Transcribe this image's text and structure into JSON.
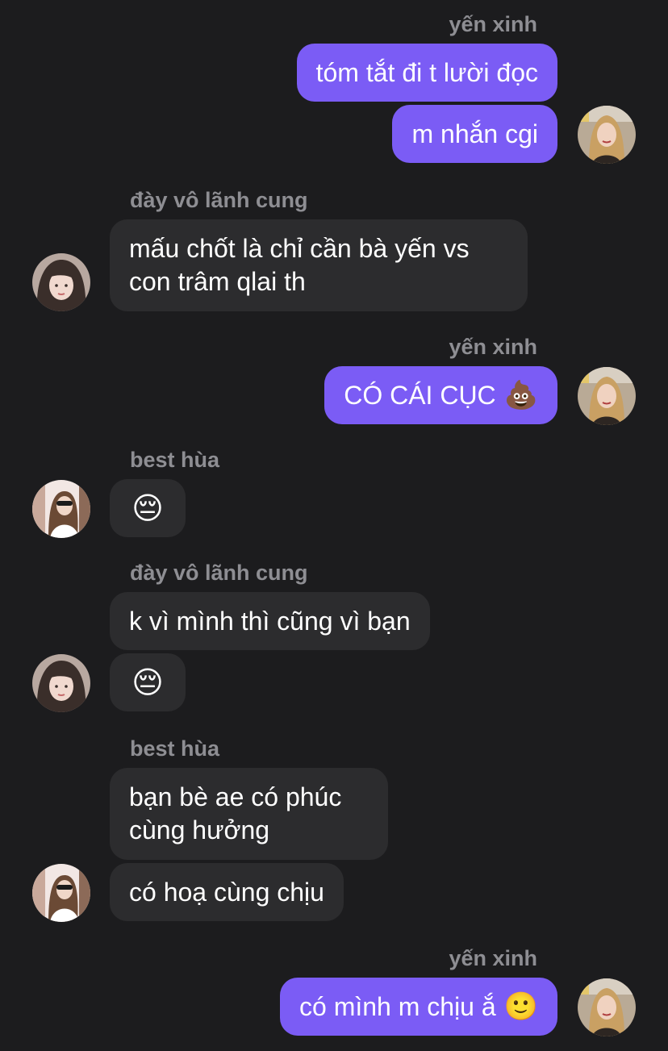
{
  "colors": {
    "background": "#1c1c1e",
    "outgoing_bubble": "#7b5cf5",
    "incoming_bubble": "#2c2c2e",
    "sender_name": "#8e8e93"
  },
  "messages": [
    {
      "sender": "yến xinh",
      "text": "tóm tắt đi t lười đọc"
    },
    {
      "text": "m nhắn cgi"
    },
    {
      "sender": "đày vô lãnh cung",
      "text": "mấu chốt là chỉ cần bà yến vs con trâm qlai th"
    },
    {
      "sender": "yến xinh",
      "text": "CÓ CÁI CỤC",
      "emoji": "💩"
    },
    {
      "sender": "best hùa",
      "emoji": "😔"
    },
    {
      "sender": "đày vô lãnh cung",
      "text": "k vì mình thì cũng vì bạn"
    },
    {
      "emoji": "😔"
    },
    {
      "sender": "best hùa",
      "text": "bạn bè ae có phúc cùng hưởng"
    },
    {
      "text": "có hoạ cùng chịu"
    },
    {
      "sender": "yến xinh",
      "text": "có mình m chịu ắ",
      "emoji": "🙂"
    }
  ],
  "avatars": {
    "yen_xinh": "avatar-yen-xinh",
    "day_vo_lanh_cung": "avatar-day-vo-lanh-cung",
    "best_hua": "avatar-best-hua"
  }
}
